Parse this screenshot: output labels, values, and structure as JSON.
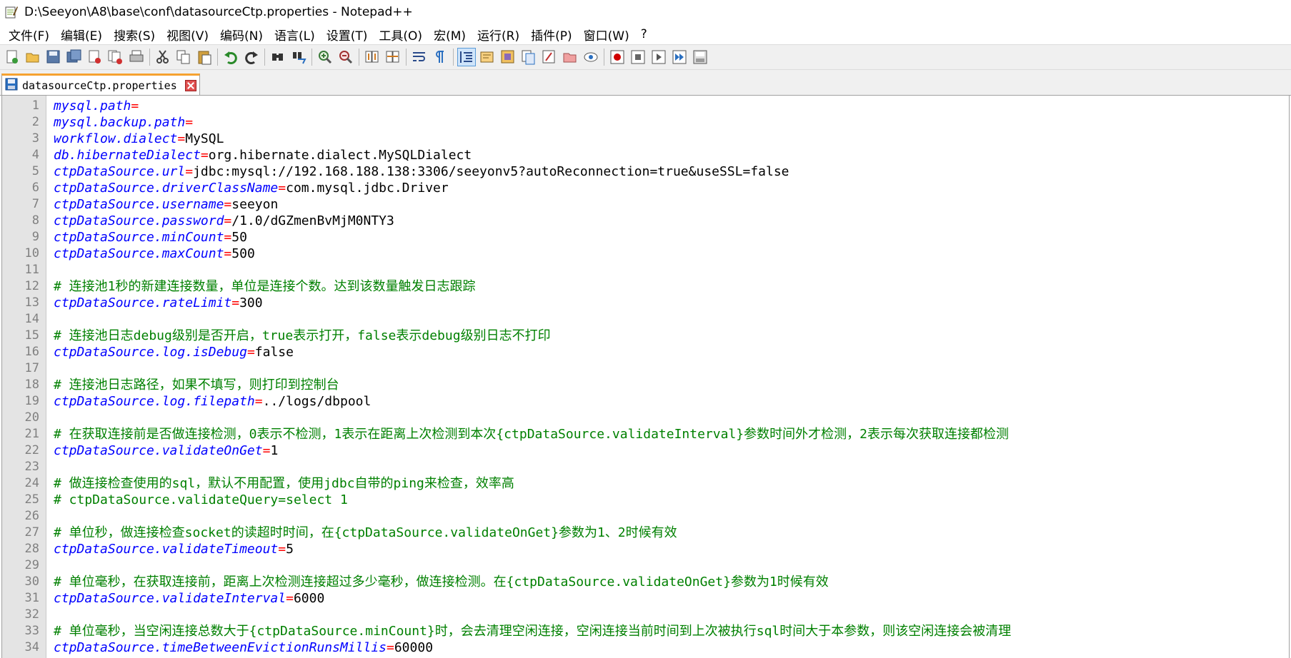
{
  "window": {
    "title": "D:\\Seeyon\\A8\\base\\conf\\datasourceCtp.properties - Notepad++"
  },
  "menu": [
    "文件(F)",
    "编辑(E)",
    "搜索(S)",
    "视图(V)",
    "编码(N)",
    "语言(L)",
    "设置(T)",
    "工具(O)",
    "宏(M)",
    "运行(R)",
    "插件(P)",
    "窗口(W)",
    "?"
  ],
  "toolbar": {
    "icons": [
      "new-file-icon",
      "open-file-icon",
      "save-icon",
      "save-all-icon",
      "close-icon",
      "close-all-icon",
      "print-icon",
      "|",
      "cut-icon",
      "copy-icon",
      "paste-icon",
      "|",
      "undo-icon",
      "redo-icon",
      "|",
      "find-icon",
      "replace-icon",
      "|",
      "zoom-in-icon",
      "zoom-out-icon",
      "|",
      "sync-vertical-icon",
      "sync-horizontal-icon",
      "|",
      "word-wrap-icon",
      "show-all-chars-icon",
      "|",
      "indent-guide-icon",
      "user-language-icon",
      "doc-map-icon",
      "function-list-icon",
      "folder-workspace-icon",
      "document-list-icon",
      "monitoring-icon",
      "|",
      "macro-record-icon",
      "macro-stop-icon",
      "macro-play-icon",
      "macro-run-multiple-icon",
      "macro-save-icon"
    ],
    "active": "indent-guide-icon",
    "colors": {
      "record": "#d00000",
      "accent": "#2a6fc0"
    }
  },
  "tab": {
    "label": "datasourceCtp.properties",
    "accent": "#f6a230"
  },
  "editor": {
    "lines": [
      {
        "k": "mysql.path",
        "v": ""
      },
      {
        "k": "mysql.backup.path",
        "v": ""
      },
      {
        "k": "workflow.dialect",
        "v": "MySQL"
      },
      {
        "k": "db.hibernateDialect",
        "v": "org.hibernate.dialect.MySQLDialect"
      },
      {
        "k": "ctpDataSource.url",
        "v": "jdbc:mysql://192.168.188.138:3306/seeyonv5?autoReconnection=true&useSSL=false"
      },
      {
        "k": "ctpDataSource.driverClassName",
        "v": "com.mysql.jdbc.Driver"
      },
      {
        "k": "ctpDataSource.username",
        "v": "seeyon"
      },
      {
        "k": "ctpDataSource.password",
        "v": "/1.0/dGZmenBvMjM0NTY3"
      },
      {
        "k": "ctpDataSource.minCount",
        "v": "50"
      },
      {
        "k": "ctpDataSource.maxCount",
        "v": "500"
      },
      {
        "t": ""
      },
      {
        "c": "# 连接池1秒的新建连接数量，单位是连接个数。达到该数量触发日志跟踪"
      },
      {
        "k": "ctpDataSource.rateLimit",
        "v": "300"
      },
      {
        "t": ""
      },
      {
        "c": "# 连接池日志debug级别是否开启，true表示打开，false表示debug级别日志不打印"
      },
      {
        "k": "ctpDataSource.log.isDebug",
        "v": "false"
      },
      {
        "t": ""
      },
      {
        "c": "# 连接池日志路径，如果不填写，则打印到控制台"
      },
      {
        "k": "ctpDataSource.log.filepath",
        "v": "../logs/dbpool"
      },
      {
        "t": ""
      },
      {
        "c": "# 在获取连接前是否做连接检测，0表示不检测，1表示在距离上次检测到本次{ctpDataSource.validateInterval}参数时间外才检测，2表示每次获取连接都检测"
      },
      {
        "k": "ctpDataSource.validateOnGet",
        "v": "1"
      },
      {
        "t": ""
      },
      {
        "c": "# 做连接检查使用的sql，默认不用配置，使用jdbc自带的ping来检查，效率高"
      },
      {
        "c": "# ctpDataSource.validateQuery=select 1"
      },
      {
        "t": ""
      },
      {
        "c": "# 单位秒，做连接检查socket的读超时时间，在{ctpDataSource.validateOnGet}参数为1、2时候有效"
      },
      {
        "k": "ctpDataSource.validateTimeout",
        "v": "5"
      },
      {
        "t": ""
      },
      {
        "c": "# 单位毫秒，在获取连接前，距离上次检测连接超过多少毫秒，做连接检测。在{ctpDataSource.validateOnGet}参数为1时候有效"
      },
      {
        "k": "ctpDataSource.validateInterval",
        "v": "6000"
      },
      {
        "t": ""
      },
      {
        "c": "# 单位毫秒，当空闲连接总数大于{ctpDataSource.minCount}时，会去清理空闲连接，空闲连接当前时间到上次被执行sql时间大于本参数，则该空闲连接会被清理"
      },
      {
        "k": "ctpDataSource.timeBetweenEvictionRunsMillis",
        "v": "60000"
      }
    ]
  }
}
